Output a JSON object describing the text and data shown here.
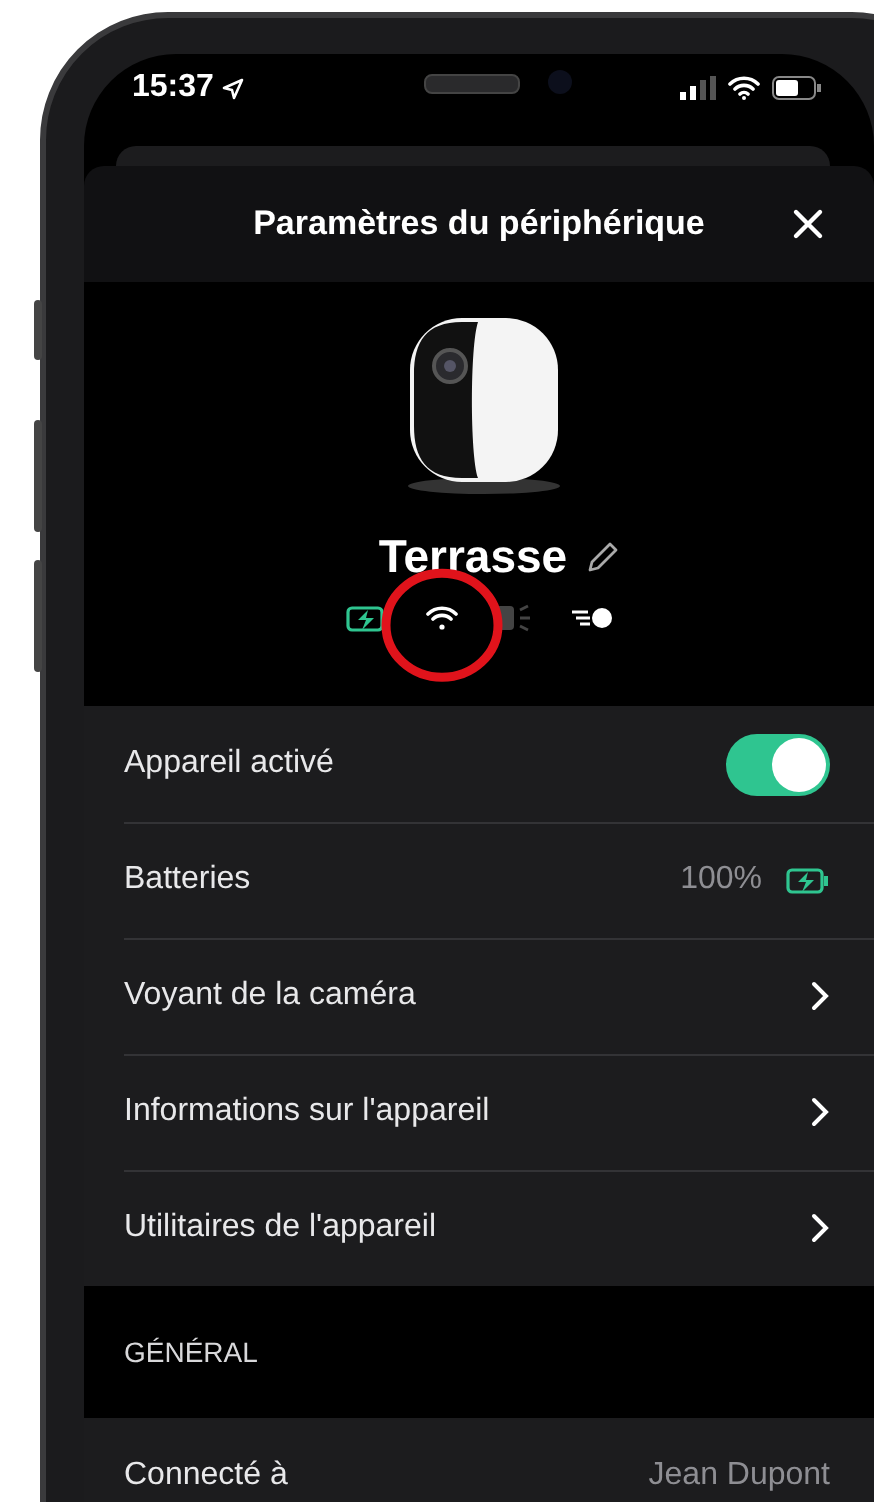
{
  "status_bar": {
    "time": "15:37"
  },
  "modal": {
    "title": "Paramètres du périphérique"
  },
  "device": {
    "name": "Terrasse"
  },
  "settings": [
    {
      "kind": "toggle",
      "label": "Appareil activé",
      "on": true
    },
    {
      "kind": "value",
      "label": "Batteries",
      "value": "100%"
    },
    {
      "kind": "link",
      "label": "Voyant de la caméra"
    },
    {
      "kind": "link",
      "label": "Informations sur l'appareil"
    },
    {
      "kind": "link",
      "label": "Utilitaires de l'appareil"
    }
  ],
  "general": {
    "heading": "GÉNÉRAL",
    "rows": [
      {
        "kind": "value",
        "label": "Connecté à",
        "value": "Jean Dupont"
      }
    ]
  }
}
